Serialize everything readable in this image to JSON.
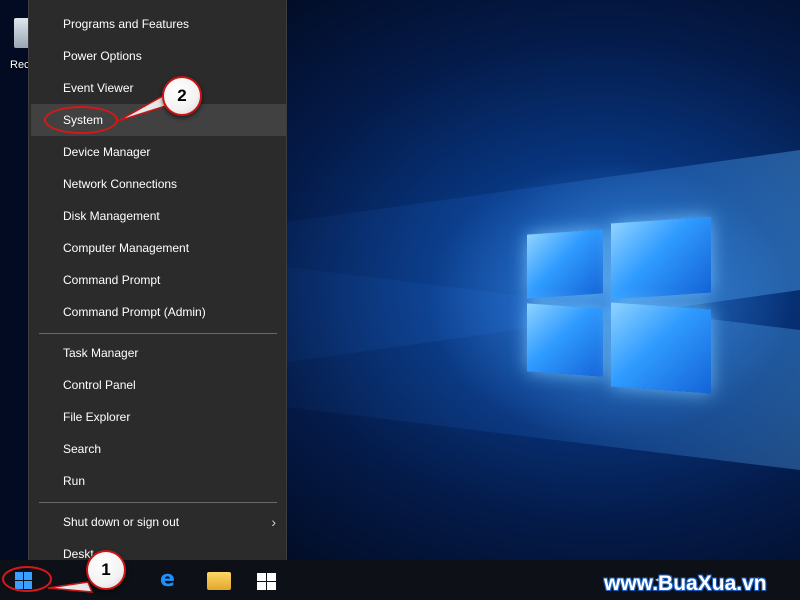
{
  "desktop": {
    "recycle_bin_label": "Rec"
  },
  "menu": {
    "group1": [
      {
        "name": "programs-and-features",
        "label": "Programs and Features"
      },
      {
        "name": "power-options",
        "label": "Power Options"
      },
      {
        "name": "event-viewer",
        "label": "Event Viewer"
      },
      {
        "name": "system",
        "label": "System"
      },
      {
        "name": "device-manager",
        "label": "Device Manager"
      },
      {
        "name": "network-connections",
        "label": "Network Connections"
      },
      {
        "name": "disk-management",
        "label": "Disk Management"
      },
      {
        "name": "computer-management",
        "label": "Computer Management"
      },
      {
        "name": "command-prompt",
        "label": "Command Prompt"
      },
      {
        "name": "command-prompt-admin",
        "label": "Command Prompt (Admin)"
      }
    ],
    "group2": [
      {
        "name": "task-manager",
        "label": "Task Manager"
      },
      {
        "name": "control-panel",
        "label": "Control Panel"
      },
      {
        "name": "file-explorer",
        "label": "File Explorer"
      },
      {
        "name": "search",
        "label": "Search"
      },
      {
        "name": "run",
        "label": "Run"
      }
    ],
    "group3": [
      {
        "name": "shut-down-or-sign-out",
        "label": "Shut down or sign out"
      },
      {
        "name": "desktop",
        "label": "Deskt"
      }
    ],
    "highlighted": "System",
    "submenu_icon": "chevron-right-icon"
  },
  "callouts": {
    "step1": "1",
    "step2": "2"
  },
  "taskbar": {
    "icons": [
      "windows-start-icon",
      "edge-icon",
      "file-explorer-icon",
      "store-icon",
      "speaker-icon"
    ]
  },
  "watermark": "www.BuaXua.vn",
  "colors": {
    "menu_bg": "#2b2b2b",
    "menu_hover": "#414141",
    "callout_border": "#c81414",
    "accent": "#3aa0ff"
  }
}
